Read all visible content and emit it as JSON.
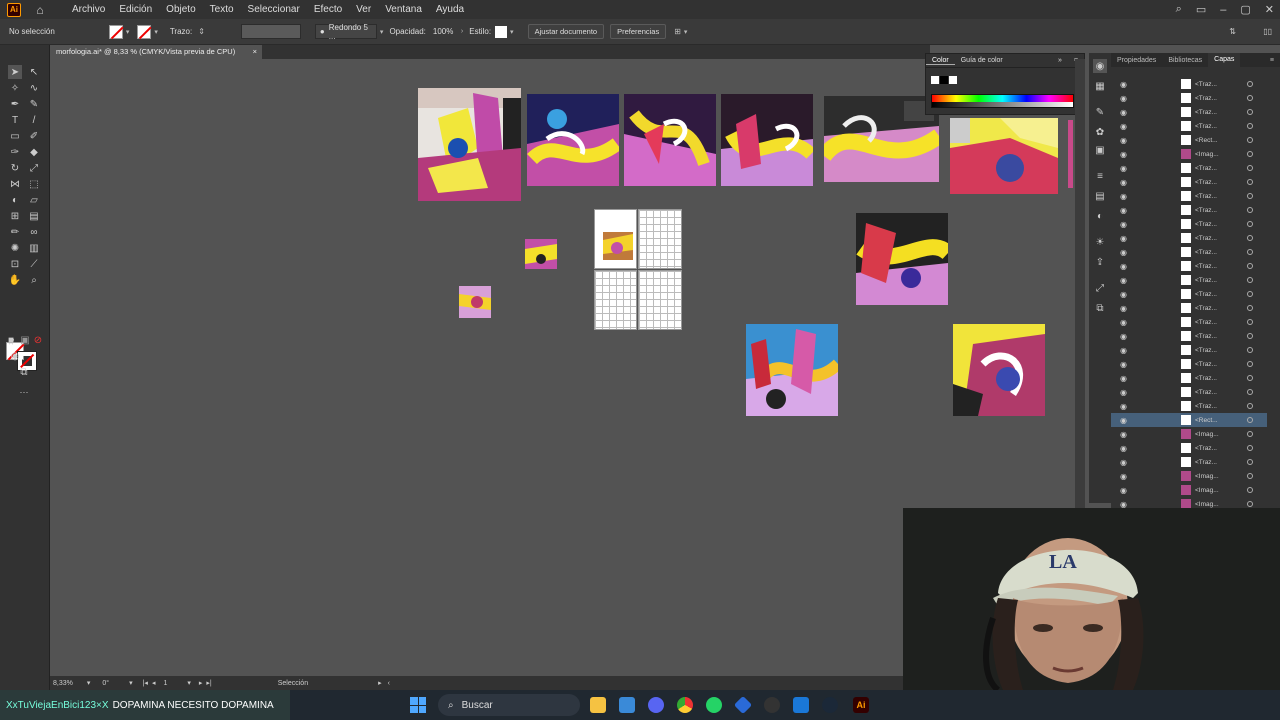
{
  "app": {
    "logo": "Ai",
    "home_icon": "home-icon"
  },
  "menu": [
    "Archivo",
    "Edición",
    "Objeto",
    "Texto",
    "Seleccionar",
    "Efecto",
    "Ver",
    "Ventana",
    "Ayuda"
  ],
  "control": {
    "selection": "No selección",
    "stroke_label": "Trazo:",
    "brush": "Redondo 5 ...",
    "opacity_label": "Opacidad:",
    "opacity_value": "100%",
    "style_label": "Estilo:",
    "fit_button": "Ajustar documento",
    "prefs_button": "Preferencias"
  },
  "document": {
    "tab_title": "morfologia.ai* @ 8,33 % (CMYK/Vista previa de CPU)",
    "close": "×"
  },
  "color_panel": {
    "tabs": [
      "Color",
      "Guía de color"
    ]
  },
  "layers_panel": {
    "tabs": [
      "Propiedades",
      "Bibliotecas",
      "Capas"
    ],
    "rows": [
      "<Traz...",
      "<Traz...",
      "<Traz...",
      "<Traz...",
      "<Rect...",
      "<Imag...",
      "<Traz...",
      "<Traz...",
      "<Traz...",
      "<Traz...",
      "<Traz...",
      "<Traz...",
      "<Traz...",
      "<Traz...",
      "<Traz...",
      "<Traz...",
      "<Traz...",
      "<Traz...",
      "<Traz...",
      "<Traz...",
      "<Traz...",
      "<Traz...",
      "<Traz...",
      "<Traz...",
      "<Rect...",
      "<Imag...",
      "<Traz...",
      "<Traz...",
      "<Imag...",
      "<Imag...",
      "<Imag..."
    ]
  },
  "status": {
    "zoom": "8,33%",
    "rotation": "0°",
    "artboard": "1",
    "mode": "Selección"
  },
  "taskbar": {
    "alert_user": "XxTuViejaEnBici123×X",
    "alert_text": "DOPAMINA NECESITO DOPAMINA",
    "search": "Buscar"
  }
}
